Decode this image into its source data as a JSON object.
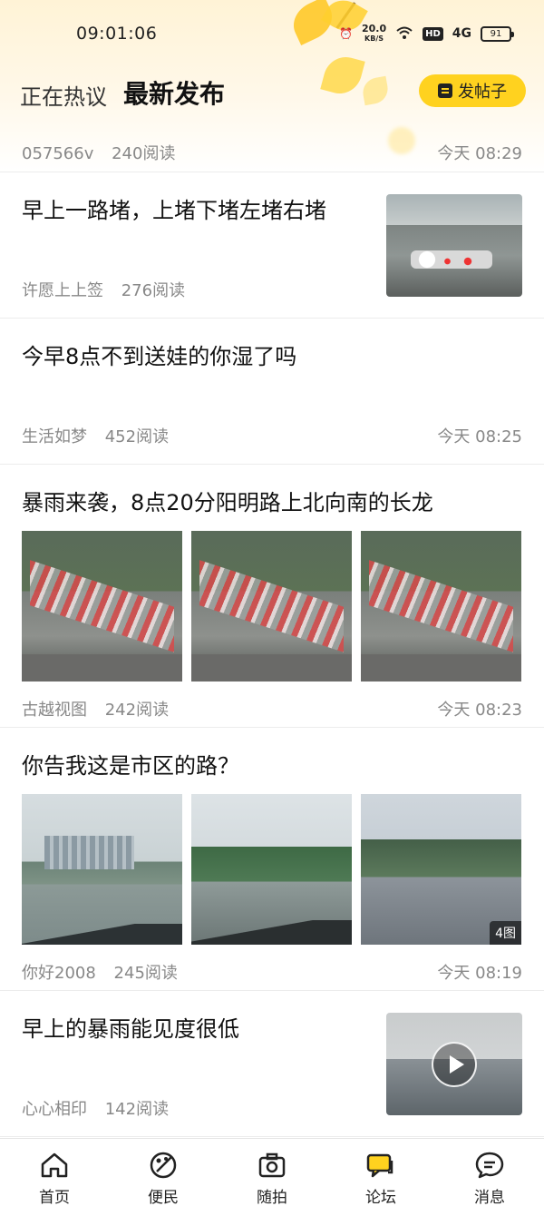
{
  "status_bar": {
    "time": "09:01:06",
    "net_speed": "20.0",
    "net_unit": "KB/S",
    "hd": "HD",
    "signal": "4G",
    "battery": "91"
  },
  "tabs": {
    "inactive": "正在热议",
    "active": "最新发布"
  },
  "post_button": {
    "label": "发帖子",
    "icon": "edit-icon"
  },
  "feed": {
    "partial": {
      "author": "057566v",
      "reads": "240阅读",
      "time": "今天 08:29"
    },
    "items": [
      {
        "title": "早上一路堵，上堵下堵左堵右堵",
        "author": "许愿上上签",
        "reads": "276阅读",
        "time": ""
      },
      {
        "title": "今早8点不到送娃的你湿了吗",
        "author": "生活如梦",
        "reads": "452阅读",
        "time": "今天 08:25"
      },
      {
        "title": "暴雨来袭，8点20分阳明路上北向南的长龙",
        "author": "古越视图",
        "reads": "242阅读",
        "time": "今天 08:23",
        "image_count": "3图"
      },
      {
        "title": "你告我这是市区的路？",
        "author": "你好2008",
        "reads": "245阅读",
        "time": "今天 08:19",
        "image_count": "4图"
      },
      {
        "title": "早上的暴雨能见度很低",
        "author": "心心相印",
        "reads": "142阅读",
        "time": ""
      }
    ]
  },
  "bottom_nav": [
    {
      "label": "首页",
      "icon": "home-icon"
    },
    {
      "label": "便民",
      "icon": "palette-icon"
    },
    {
      "label": "随拍",
      "icon": "camera-icon"
    },
    {
      "label": "论坛",
      "icon": "chat-bubbles-icon",
      "active_color": "#ffd21f"
    },
    {
      "label": "消息",
      "icon": "message-icon"
    }
  ],
  "colors": {
    "accent": "#ffd21f",
    "meta_text": "#888888"
  }
}
